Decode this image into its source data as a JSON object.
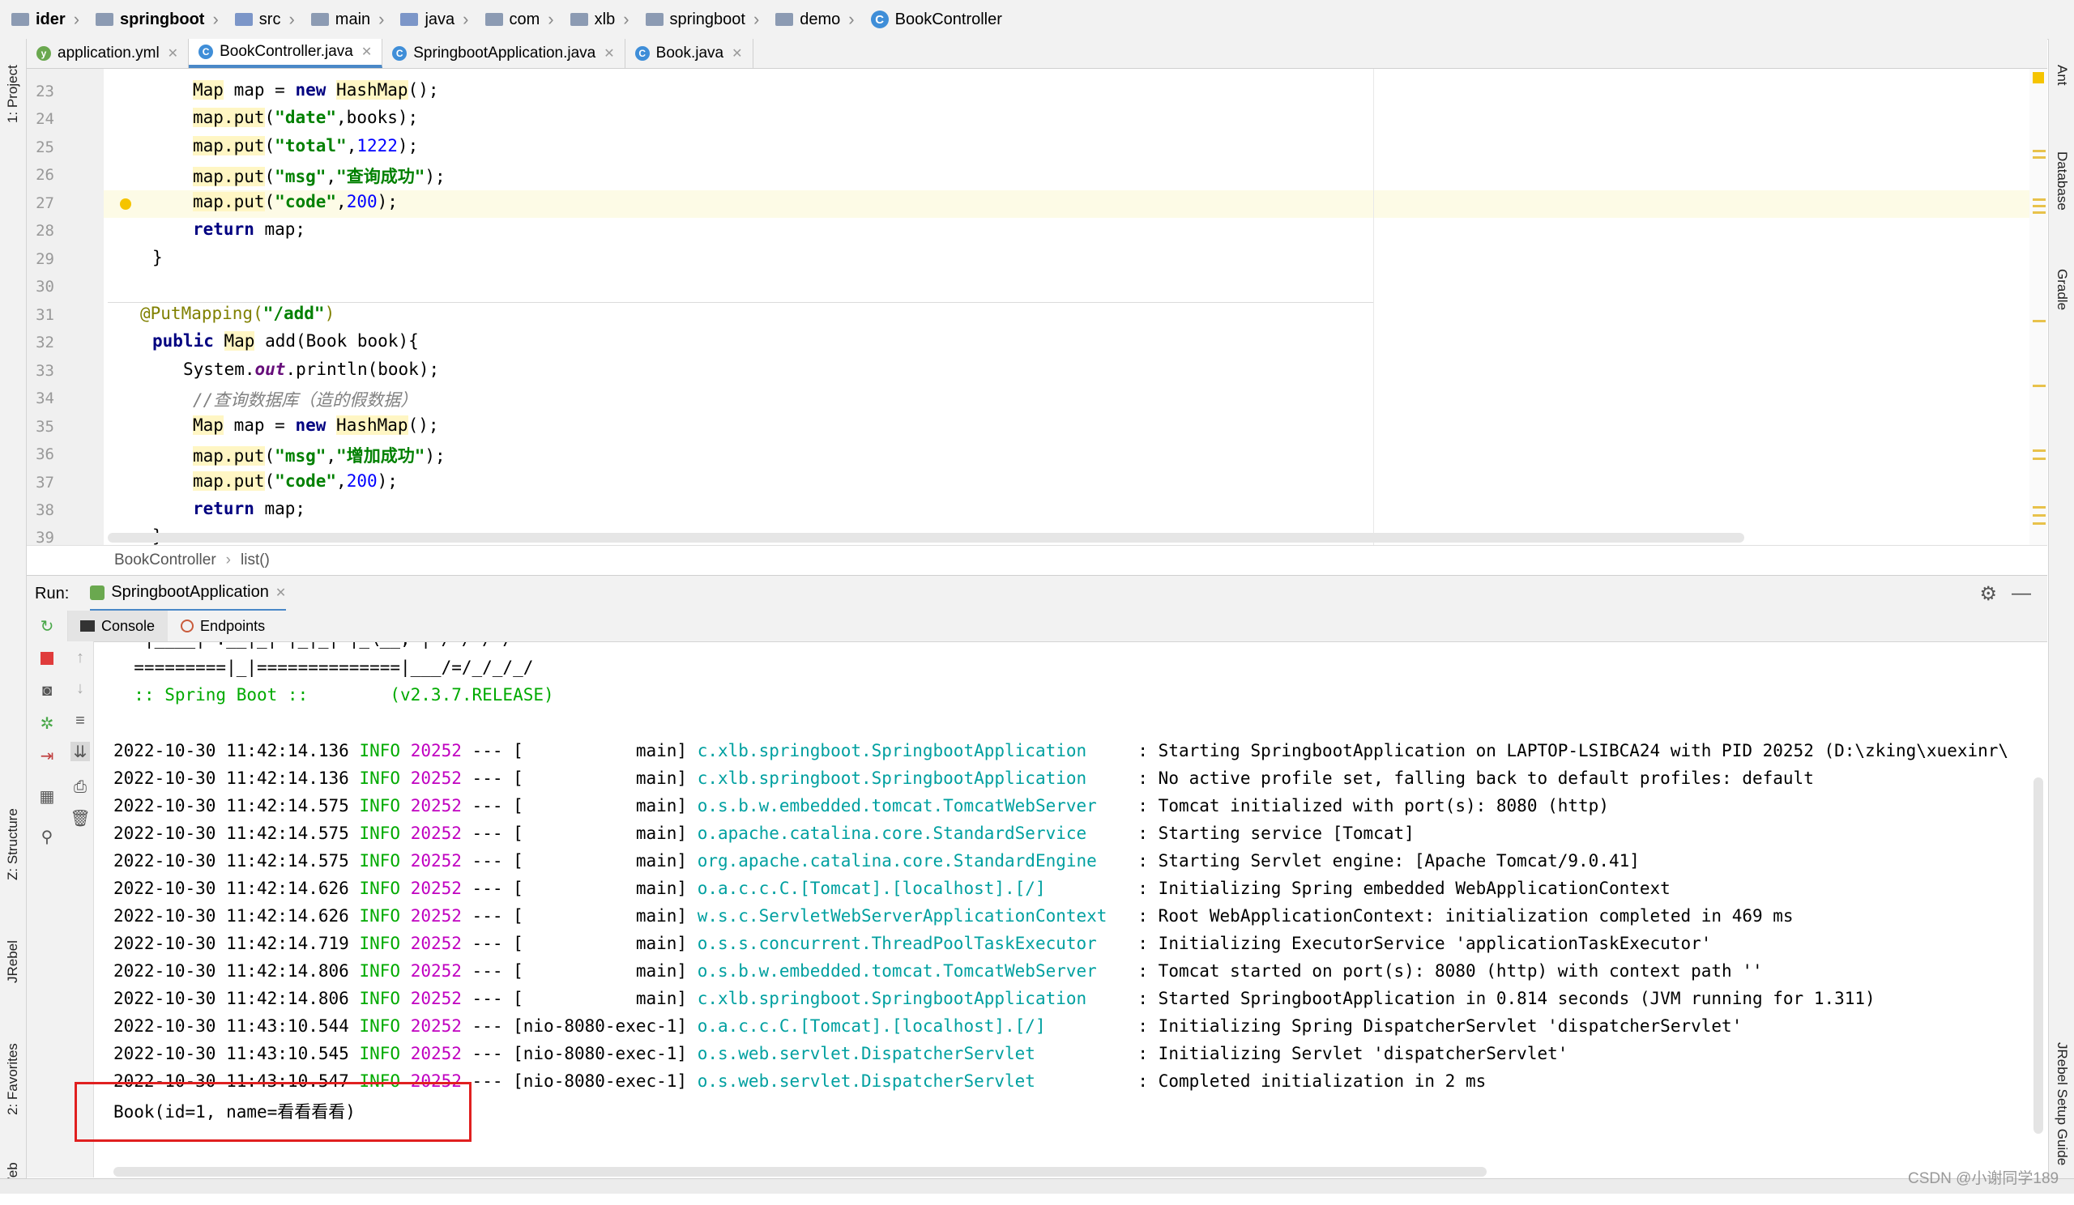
{
  "breadcrumb": {
    "items": [
      "ider",
      "springboot",
      "src",
      "main",
      "java",
      "com",
      "xlb",
      "springboot",
      "demo",
      "BookController"
    ]
  },
  "left_tools": [
    "1: Project",
    "Z: Structure",
    "JRebel",
    "2: Favorites",
    "Web"
  ],
  "right_tools": [
    "Ant",
    "Database",
    "Gradle",
    "JRebel Setup Guide"
  ],
  "tabs": [
    {
      "label": "application.yml",
      "icon": "yaml-file-icon",
      "active": false
    },
    {
      "label": "BookController.java",
      "icon": "java-class-icon",
      "active": true
    },
    {
      "label": "SpringbootApplication.java",
      "icon": "java-class-icon",
      "active": false
    },
    {
      "label": "Book.java",
      "icon": "java-class-icon",
      "active": false
    }
  ],
  "editor": {
    "line_numbers": [
      "23",
      "24",
      "25",
      "26",
      "27",
      "28",
      "29",
      "30",
      "31",
      "32",
      "33",
      "34",
      "35",
      "36",
      "37",
      "38",
      "39"
    ],
    "crumb": [
      "BookController",
      "list()"
    ]
  },
  "run": {
    "label": "Run:",
    "config": "SpringbootApplication",
    "subtabs": [
      "Console",
      "Endpoints"
    ]
  },
  "console": {
    "banner": [
      "   |____| .__|_| |_|_| |_\\__, | / / / /",
      "  =========|_|==============|___/=/_/_/_/",
      "  :: Spring Boot ::        (v2.3.7.RELEASE)"
    ],
    "logs": [
      {
        "ts": "2022-10-30 11:42:14.136",
        "level": "INFO",
        "pid": "20252",
        "thread": "[           main]",
        "logger": "c.xlb.springboot.SpringbootApplication   ",
        "msg": ": Starting SpringbootApplication on LAPTOP-LSIBCA24 with PID 20252 (D:\\zking\\xuexinr\\"
      },
      {
        "ts": "2022-10-30 11:42:14.136",
        "level": "INFO",
        "pid": "20252",
        "thread": "[           main]",
        "logger": "c.xlb.springboot.SpringbootApplication   ",
        "msg": ": No active profile set, falling back to default profiles: default"
      },
      {
        "ts": "2022-10-30 11:42:14.575",
        "level": "INFO",
        "pid": "20252",
        "thread": "[           main]",
        "logger": "o.s.b.w.embedded.tomcat.TomcatWebServer  ",
        "msg": ": Tomcat initialized with port(s): 8080 (http)"
      },
      {
        "ts": "2022-10-30 11:42:14.575",
        "level": "INFO",
        "pid": "20252",
        "thread": "[           main]",
        "logger": "o.apache.catalina.core.StandardService   ",
        "msg": ": Starting service [Tomcat]"
      },
      {
        "ts": "2022-10-30 11:42:14.575",
        "level": "INFO",
        "pid": "20252",
        "thread": "[           main]",
        "logger": "org.apache.catalina.core.StandardEngine  ",
        "msg": ": Starting Servlet engine: [Apache Tomcat/9.0.41]"
      },
      {
        "ts": "2022-10-30 11:42:14.626",
        "level": "INFO",
        "pid": "20252",
        "thread": "[           main]",
        "logger": "o.a.c.c.C.[Tomcat].[localhost].[/]       ",
        "msg": ": Initializing Spring embedded WebApplicationContext"
      },
      {
        "ts": "2022-10-30 11:42:14.626",
        "level": "INFO",
        "pid": "20252",
        "thread": "[           main]",
        "logger": "w.s.c.ServletWebServerApplicationContext ",
        "msg": ": Root WebApplicationContext: initialization completed in 469 ms"
      },
      {
        "ts": "2022-10-30 11:42:14.719",
        "level": "INFO",
        "pid": "20252",
        "thread": "[           main]",
        "logger": "o.s.s.concurrent.ThreadPoolTaskExecutor  ",
        "msg": ": Initializing ExecutorService 'applicationTaskExecutor'"
      },
      {
        "ts": "2022-10-30 11:42:14.806",
        "level": "INFO",
        "pid": "20252",
        "thread": "[           main]",
        "logger": "o.s.b.w.embedded.tomcat.TomcatWebServer  ",
        "msg": ": Tomcat started on port(s): 8080 (http) with context path ''"
      },
      {
        "ts": "2022-10-30 11:42:14.806",
        "level": "INFO",
        "pid": "20252",
        "thread": "[           main]",
        "logger": "c.xlb.springboot.SpringbootApplication   ",
        "msg": ": Started SpringbootApplication in 0.814 seconds (JVM running for 1.311)"
      },
      {
        "ts": "2022-10-30 11:43:10.544",
        "level": "INFO",
        "pid": "20252",
        "thread": "[nio-8080-exec-1]",
        "logger": "o.a.c.c.C.[Tomcat].[localhost].[/]       ",
        "msg": ": Initializing Spring DispatcherServlet 'dispatcherServlet'"
      },
      {
        "ts": "2022-10-30 11:43:10.545",
        "level": "INFO",
        "pid": "20252",
        "thread": "[nio-8080-exec-1]",
        "logger": "o.s.web.servlet.DispatcherServlet        ",
        "msg": ": Initializing Servlet 'dispatcherServlet'"
      },
      {
        "ts": "2022-10-30 11:43:10.547",
        "level": "INFO",
        "pid": "20252",
        "thread": "[nio-8080-exec-1]",
        "logger": "o.s.web.servlet.DispatcherServlet        ",
        "msg": ": Completed initialization in 2 ms"
      }
    ],
    "output_line": "Book(id=1, name=看看看看)"
  },
  "watermark": "CSDN @小谢同学189",
  "colors": {
    "accent": "#4a88c7",
    "highlight_box": "#e02020",
    "log_level": "#00aa00",
    "pid": "#c000c0",
    "logger": "#00a0a0"
  }
}
